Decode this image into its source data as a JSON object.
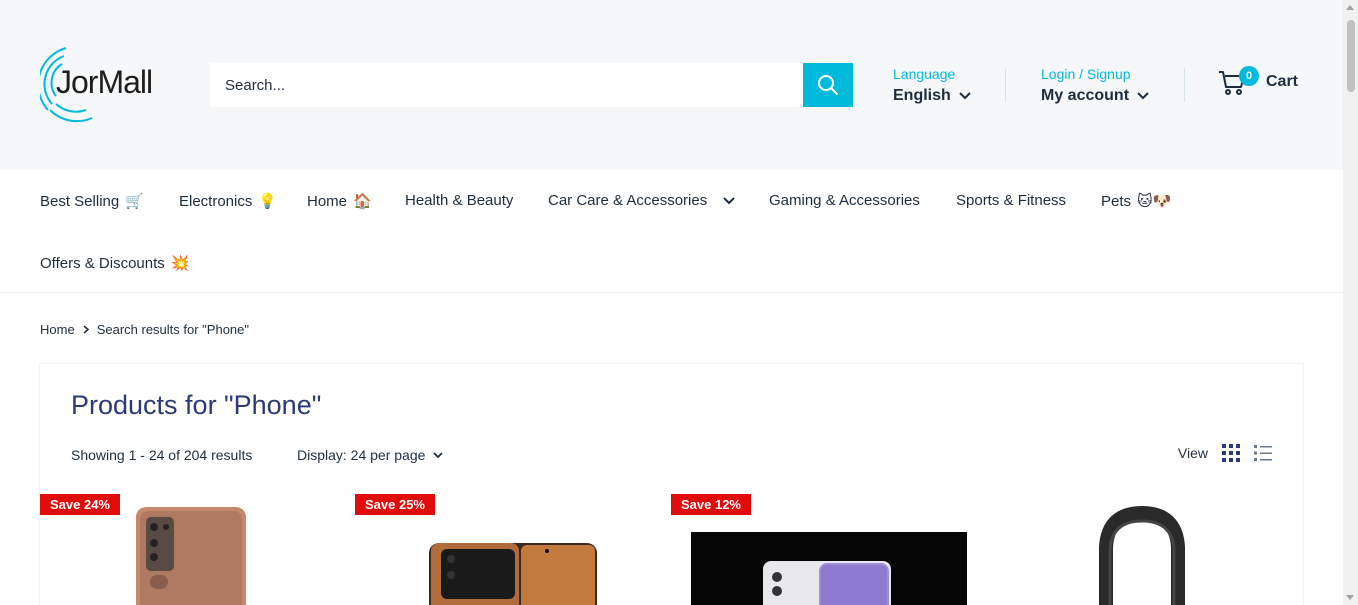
{
  "brand": {
    "logo_text": "JorMall"
  },
  "search": {
    "placeholder": "Search..."
  },
  "language": {
    "label": "Language",
    "value": "English"
  },
  "account": {
    "label": "Login / Signup",
    "value": "My account"
  },
  "cart": {
    "count": "0",
    "label": "Cart"
  },
  "nav": {
    "items": [
      {
        "label": "Best Selling",
        "emoji": "🛒"
      },
      {
        "label": "Electronics",
        "emoji": "💡"
      },
      {
        "label": "Home",
        "emoji": "🏠"
      },
      {
        "label": "Health & Beauty",
        "emoji": ""
      },
      {
        "label": "Car Care & Accessories",
        "emoji": ""
      },
      {
        "label": "Gaming & Accessories",
        "emoji": ""
      },
      {
        "label": "Sports & Fitness",
        "emoji": ""
      },
      {
        "label": "Pets",
        "emoji": "🐱🐶"
      },
      {
        "label": "Offers & Discounts",
        "emoji": "💥"
      }
    ]
  },
  "breadcrumb": {
    "home": "Home",
    "current": "Search results for \"Phone\""
  },
  "page": {
    "title": "Products for \"Phone\"",
    "results": "Showing 1 - 24 of 204 results",
    "display": "Display: 24 per page",
    "view_label": "View"
  },
  "products": [
    {
      "badge": "Save 24%"
    },
    {
      "badge": "Save 25%"
    },
    {
      "badge": "Save 12%"
    },
    {
      "badge": ""
    }
  ],
  "colors": {
    "accent": "#00badb",
    "sale": "#e00b0b",
    "title": "#2a3a7a"
  }
}
